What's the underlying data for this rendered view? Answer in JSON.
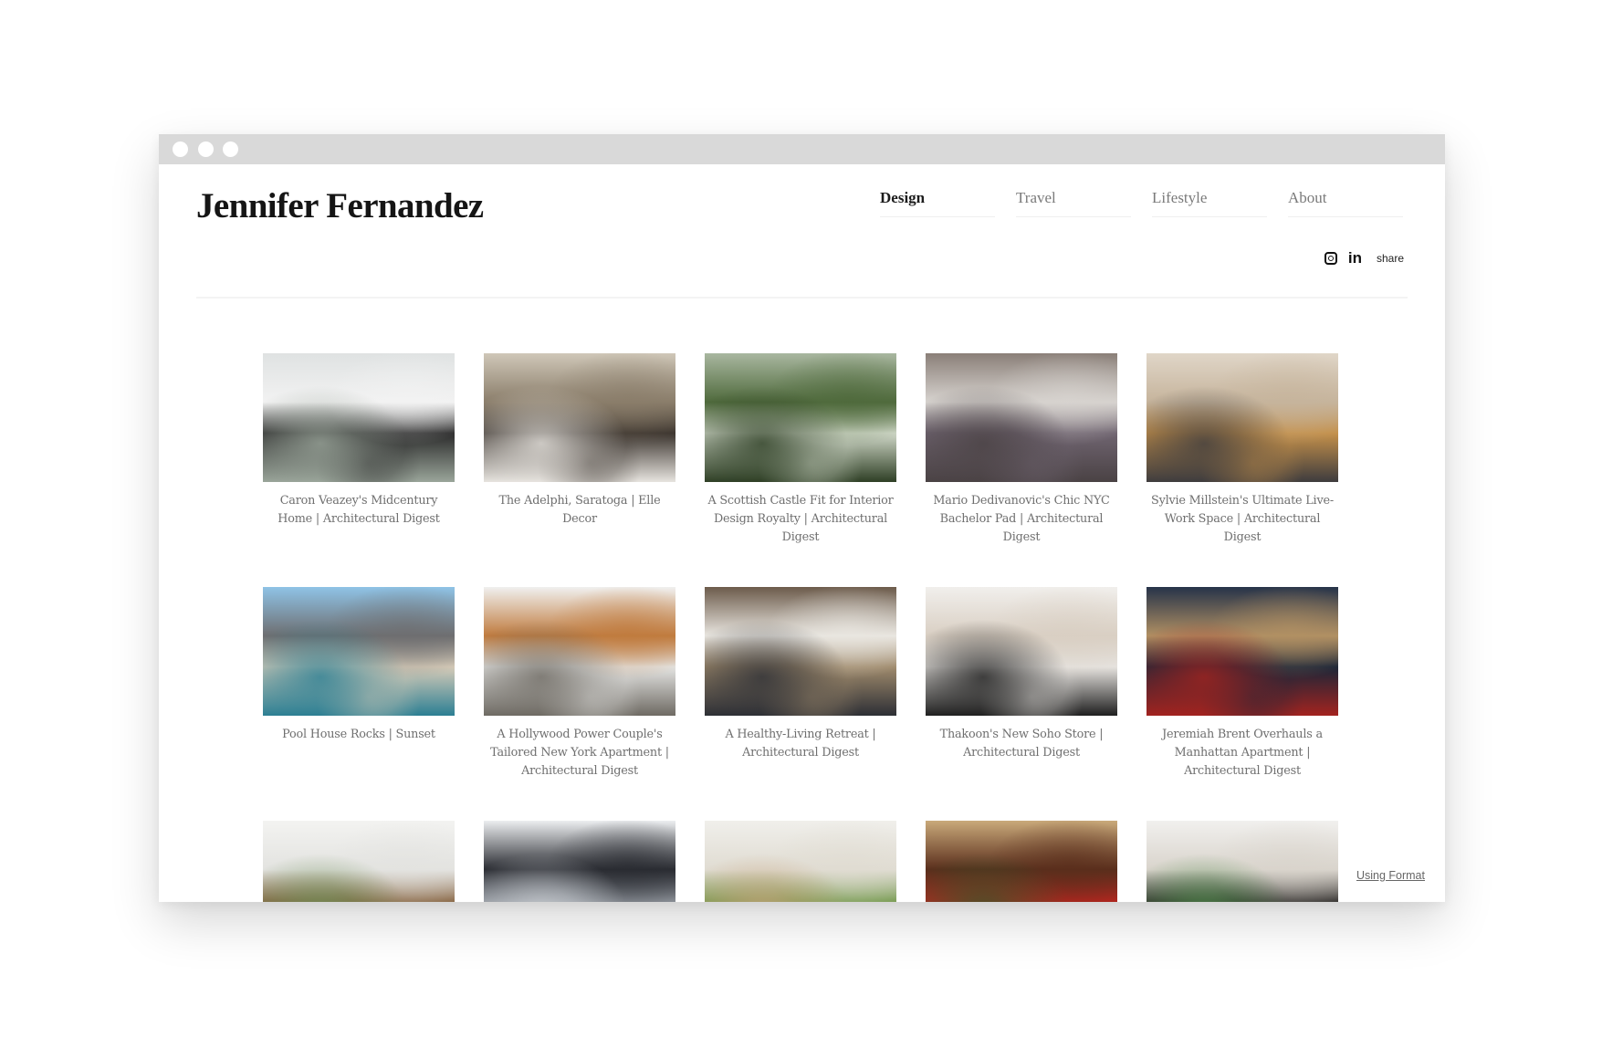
{
  "window": {
    "controls": [
      "close",
      "minimize",
      "maximize"
    ]
  },
  "site": {
    "title": "Jennifer Fernandez"
  },
  "nav": {
    "items": [
      {
        "label": "Design",
        "active": true
      },
      {
        "label": "Travel",
        "active": false
      },
      {
        "label": "Lifestyle",
        "active": false
      },
      {
        "label": "About",
        "active": false
      }
    ]
  },
  "social": {
    "instagram_icon": "instagram-icon",
    "linkedin_label": "in",
    "share_label": "share"
  },
  "gallery": {
    "items": [
      {
        "caption": "Caron Veazey's Midcentury Home | Architectural Digest",
        "tones": [
          "#dfe2e2",
          "#f2f2f2",
          "#9aa59a",
          "#2b2b2b"
        ]
      },
      {
        "caption": "The Adelphi, Saratoga | Elle Decor",
        "tones": [
          "#cfc7b8",
          "#8a7d6a",
          "#e7e4df",
          "#3b342e"
        ]
      },
      {
        "caption": "A Scottish Castle Fit for Interior Design Royalty | Architectural Digest",
        "tones": [
          "#a9b7a0",
          "#4f6a3c",
          "#2e3f25",
          "#cfd7c7"
        ]
      },
      {
        "caption": "Mario Dedivanovic's Chic NYC Bachelor Pad | Architectural Digest",
        "tones": [
          "#8a7f78",
          "#d7d3cf",
          "#4a4244",
          "#6f6470"
        ]
      },
      {
        "caption": "Sylvie Millstein's Ultimate Live-Work Space | Architectural Digest",
        "tones": [
          "#e0d6c8",
          "#c6b49c",
          "#3e3c3e",
          "#c4904a"
        ]
      },
      {
        "caption": "Pool House Rocks | Sunset",
        "tones": [
          "#8fc3e6",
          "#6e6e70",
          "#2c7f93",
          "#d6cbb8"
        ]
      },
      {
        "caption": "A Hollywood Power Couple's Tailored New York Apartment | Architectural Digest",
        "tones": [
          "#f0f0ef",
          "#c07b3e",
          "#6e6a63",
          "#e4e4e2"
        ]
      },
      {
        "caption": "A Healthy-Living Retreat | Architectural Digest",
        "tones": [
          "#6c5b4b",
          "#e9e6e0",
          "#2d2f35",
          "#9f8a6c"
        ]
      },
      {
        "caption": "Thakoon's New Soho Store | Architectural Digest",
        "tones": [
          "#f1efec",
          "#d9cfc3",
          "#1f1f1f",
          "#e6e3df"
        ]
      },
      {
        "caption": "Jeremiah Brent Overhauls a Manhattan Apartment | Architectural Digest",
        "tones": [
          "#263349",
          "#b19063",
          "#a3231f",
          "#1c2638"
        ]
      },
      {
        "caption": "",
        "tones": [
          "#f3f3f1",
          "#e3e3e0",
          "#6d8f57",
          "#8c6b4a"
        ]
      },
      {
        "caption": "",
        "tones": [
          "#eceef0",
          "#2a2c32",
          "#c9cdd2",
          "#8a8f96"
        ]
      },
      {
        "caption": "",
        "tones": [
          "#f0efeb",
          "#e0dcd2",
          "#c7a27a",
          "#7a9d55"
        ]
      },
      {
        "caption": "",
        "tones": [
          "#c9a97a",
          "#5a2e1c",
          "#2f5a2a",
          "#b2261f"
        ]
      },
      {
        "caption": "",
        "tones": [
          "#f1f0ee",
          "#d9d4cc",
          "#4e8a4a",
          "#3b3836"
        ]
      }
    ]
  },
  "footer": {
    "link_label": "Using Format"
  }
}
